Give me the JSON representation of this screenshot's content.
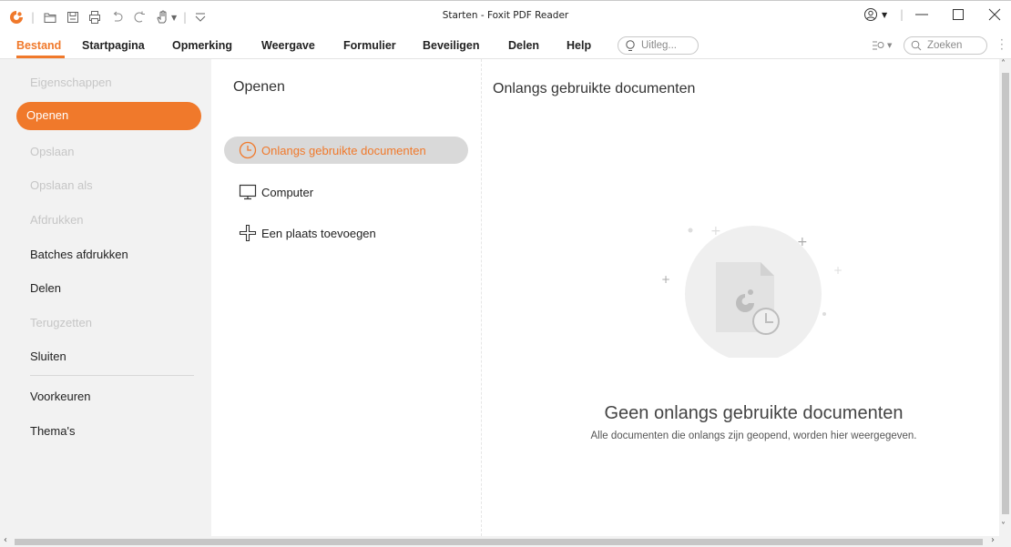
{
  "window": {
    "title": "Starten - Foxit PDF Reader"
  },
  "colors": {
    "accent": "#f0792b",
    "panel": "#f2f2f2",
    "selected": "#d9d9d9"
  },
  "quick_access_icons": [
    "foxit-logo-icon",
    "open-folder-icon",
    "save-icon",
    "print-icon",
    "undo-icon",
    "redo-icon",
    "hand-tool-icon",
    "customize-arrow-icon"
  ],
  "ribbon": {
    "tabs": [
      "Bestand",
      "Startpagina",
      "Opmerking",
      "Weergave",
      "Formulier",
      "Beveiligen",
      "Delen",
      "Help"
    ],
    "tell_me_placeholder": "Uitleg...",
    "search_placeholder": "Zoeken"
  },
  "backstage_menu": {
    "items": [
      {
        "label": "Eigenschappen",
        "state": "disabled"
      },
      {
        "label": "Openen",
        "state": "active"
      },
      {
        "label": "Opslaan",
        "state": "disabled"
      },
      {
        "label": "Opslaan als",
        "state": "disabled"
      },
      {
        "label": "Afdrukken",
        "state": "disabled"
      },
      {
        "label": "Batches afdrukken",
        "state": "enabled"
      },
      {
        "label": "Delen",
        "state": "enabled"
      },
      {
        "label": "Terugzetten",
        "state": "disabled"
      },
      {
        "label": "Sluiten",
        "state": "enabled"
      },
      {
        "label": "Voorkeuren",
        "state": "enabled"
      },
      {
        "label": "Thema's",
        "state": "enabled"
      }
    ]
  },
  "open_panel": {
    "title": "Openen",
    "options": [
      {
        "label": "Onlangs gebruikte documenten",
        "icon": "clock-icon",
        "selected": true
      },
      {
        "label": "Computer",
        "icon": "monitor-icon",
        "selected": false
      },
      {
        "label": "Een plaats toevoegen",
        "icon": "plus-icon",
        "selected": false
      }
    ]
  },
  "recent_panel": {
    "title": "Onlangs gebruikte documenten",
    "empty_title": "Geen onlangs gebruikte documenten",
    "empty_subtitle": "Alle documenten die onlangs zijn geopend, worden hier weergegeven."
  }
}
